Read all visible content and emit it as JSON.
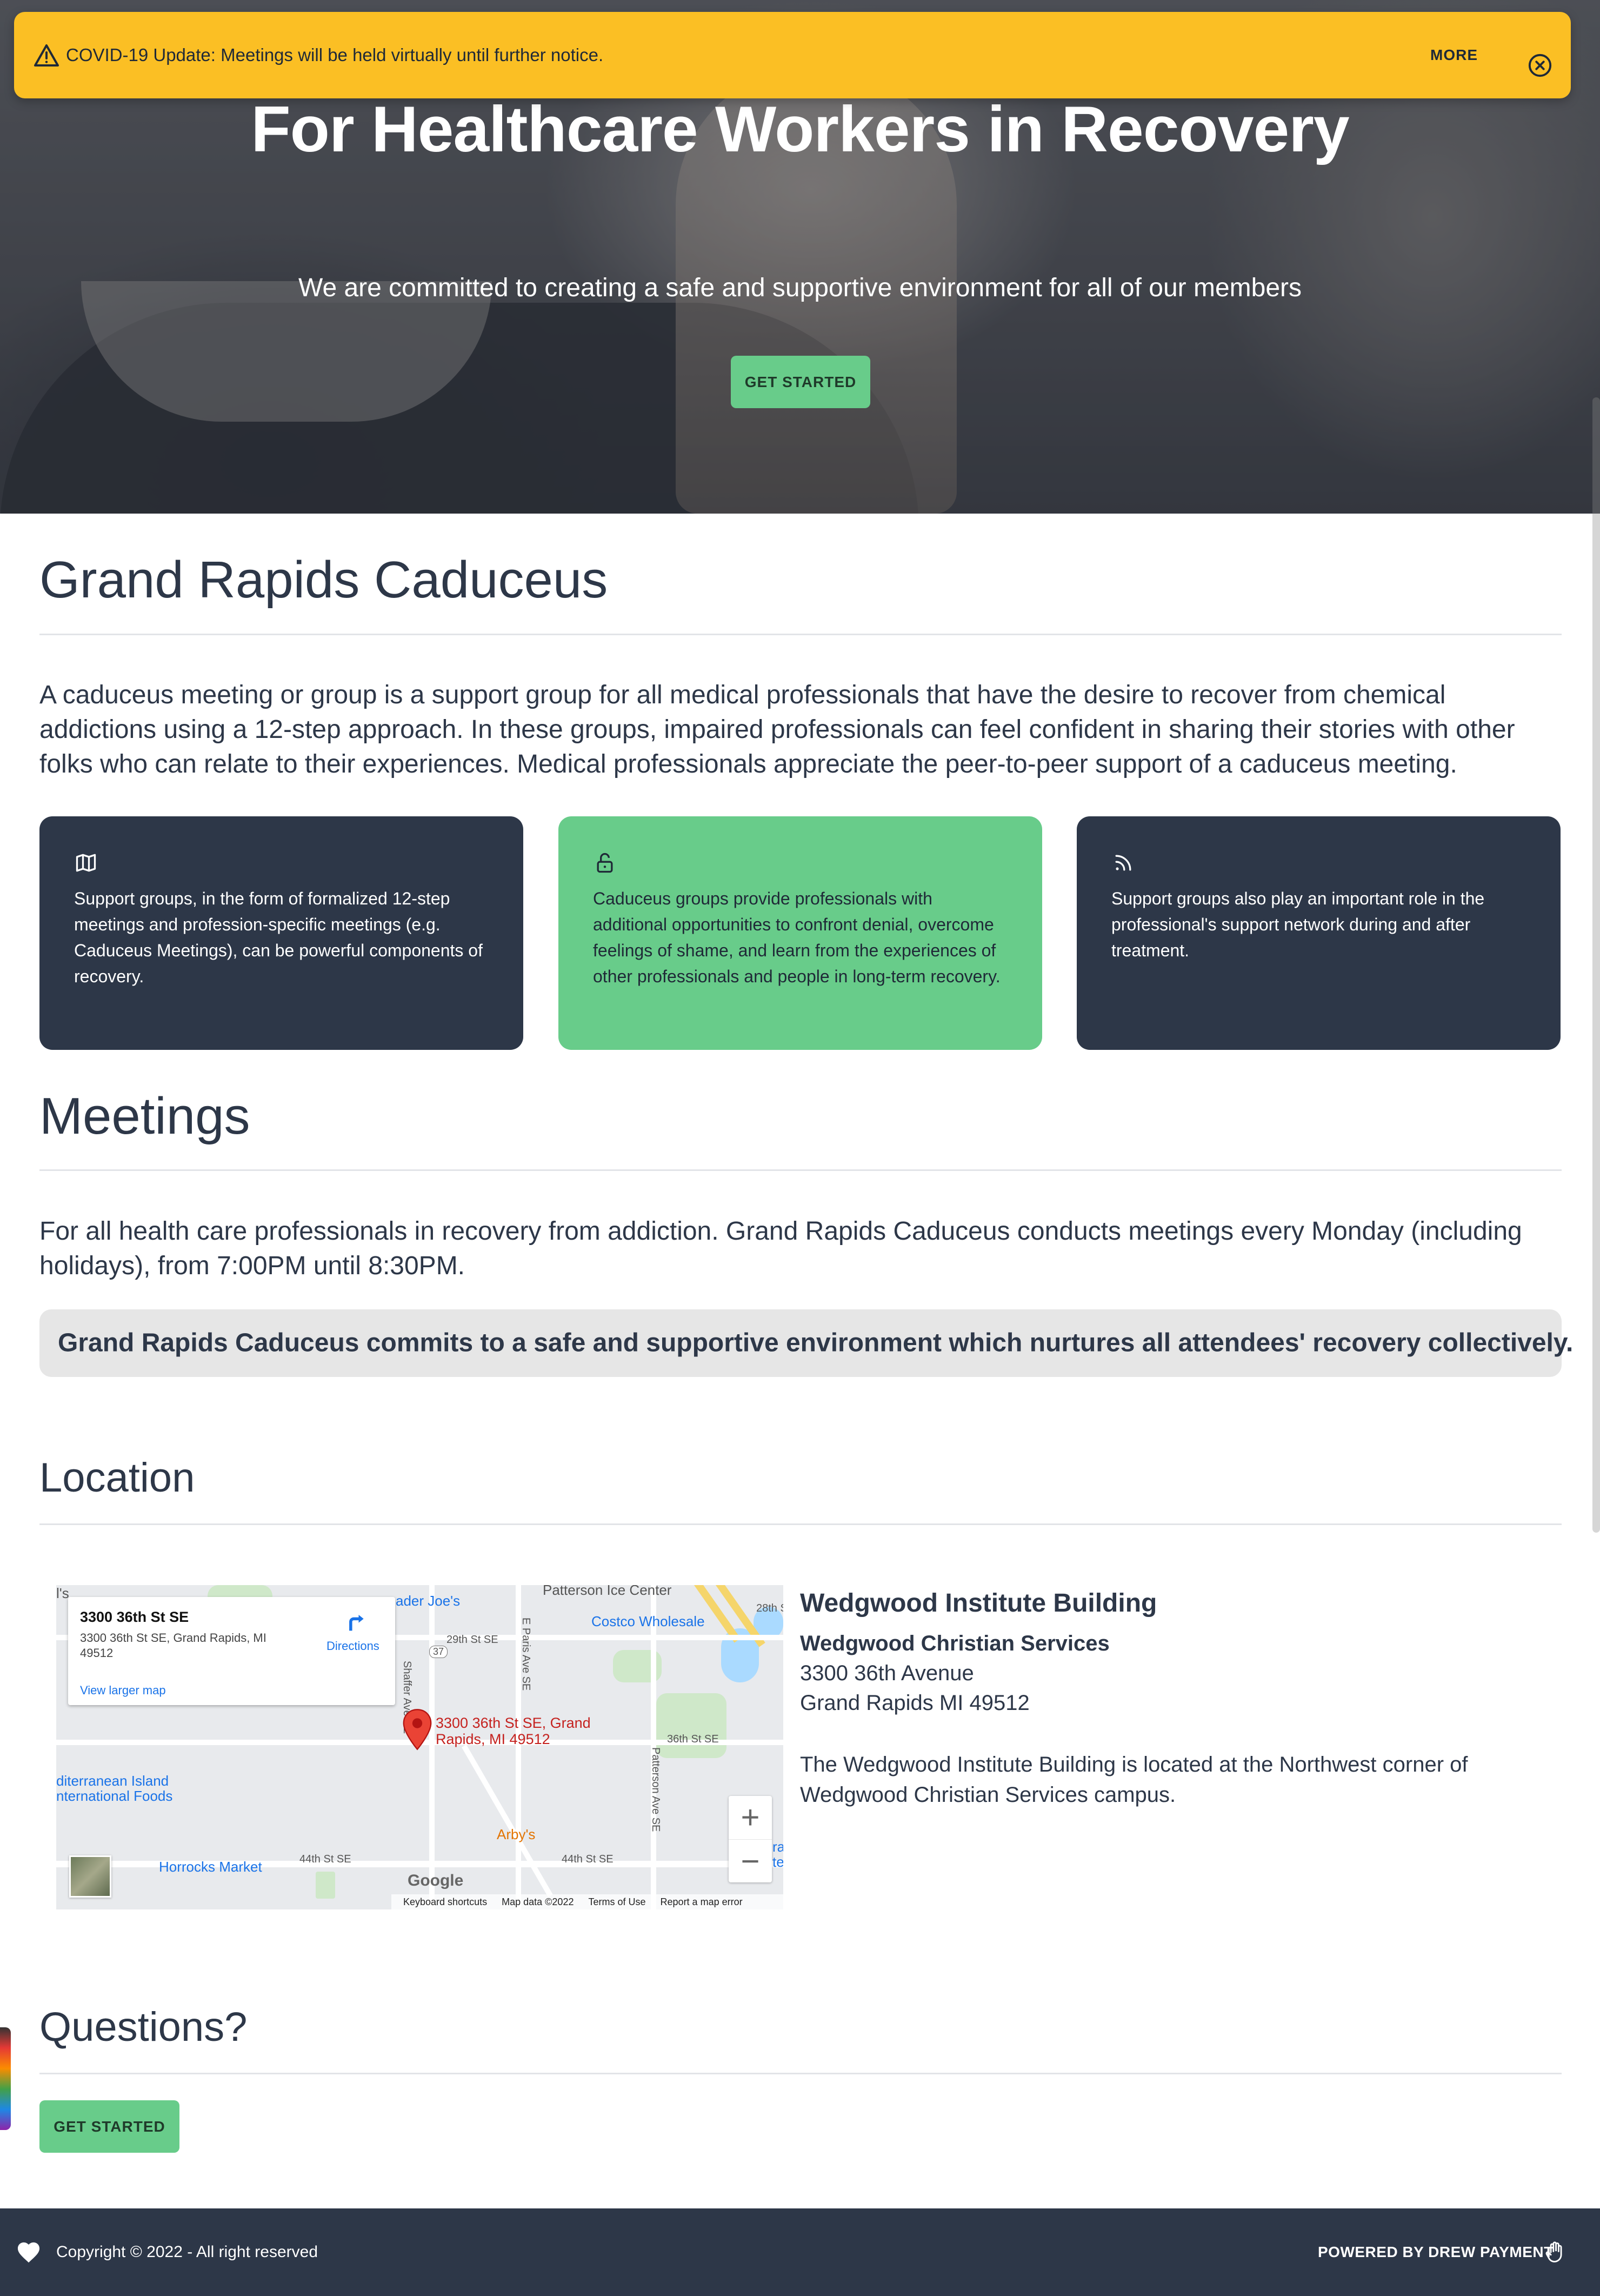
{
  "alert": {
    "message": "COVID-19 Update: Meetings will be held virtually until further notice.",
    "more_label": "MORE",
    "warning_icon": "warning-triangle-icon",
    "close_icon": "close-circle-icon",
    "background_color": "#fbbf24"
  },
  "hero": {
    "title": "For Healthcare Workers in Recovery",
    "subtitle": "We are committed to creating a safe and supportive environment for all of our members",
    "cta_label": "GET STARTED"
  },
  "about": {
    "heading": "Grand Rapids Caduceus",
    "paragraph": "A caduceus meeting or group is a support group for all medical professionals that have the desire to recover from chemical addictions using a 12-step approach. In these groups, impaired professionals can feel confident in sharing their stories with other folks who can relate to their experiences. Medical professionals appreciate the peer-to-peer support of a caduceus meeting.",
    "cards": [
      {
        "icon": "map-icon",
        "text": "Support groups, in the form of formalized 12-step meetings and profession-specific meetings (e.g. Caduceus Meetings), can be powerful components of recovery.",
        "color": "#2d3748"
      },
      {
        "icon": "unlock-icon",
        "text": "Caduceus groups provide professionals with additional opportunities to confront denial, overcome feelings of shame, and learn from the experiences of other professionals and people in long-term recovery.",
        "color": "#68cc8a"
      },
      {
        "icon": "rss-icon",
        "text": "Support groups also play an important role in the professional's support network during and after treatment.",
        "color": "#2d3748"
      }
    ]
  },
  "meetings": {
    "heading": "Meetings",
    "paragraph": "For all health care professionals in recovery from addiction. Grand Rapids Caduceus conducts meetings every Monday (including holidays), from 7:00PM until 8:30PM.",
    "quote": "Grand Rapids Caduceus commits to a safe and supportive environment which nurtures all attendees' recovery collectively."
  },
  "location": {
    "heading": "Location",
    "map": {
      "info_title": "3300 36th St SE",
      "info_address": "3300 36th St SE, Grand Rapids, MI 49512",
      "directions_label": "Directions",
      "larger_map_label": "View larger map",
      "pin_label": "3300 36th St SE, Grand Rapids, MI 49512",
      "labels": {
        "traders_joe": "ader Joe's",
        "patterson_ice": "Patterson Ice Center",
        "costco": "Costco Wholesale",
        "st29": "29th St SE",
        "st28": "28th S",
        "st36": "36th St SE",
        "st44a": "44th St SE",
        "st44b": "44th St SE",
        "shaffer": "Shaffer Ave SE",
        "eparis": "E Paris Ave SE",
        "patterson_ave": "Patterson Ave SE",
        "route37": "37",
        "mediterranean": "diterranean Island\nnternational Foods",
        "arbys": "Arby's",
        "horrocks": "Horrocks Market",
        "edge_ls": "l's",
        "edge_ra": "ra\nte"
      },
      "google_logo": "Google",
      "footer_links": [
        "Keyboard shortcuts",
        "Map data ©2022",
        "Terms of Use",
        "Report a map error"
      ],
      "zoom_in": "+",
      "zoom_out": "−"
    },
    "building": "Wedgwood Institute Building",
    "organization": "Wedgwood Christian Services",
    "street": "3300 36th Avenue",
    "city": "Grand Rapids MI 49512",
    "description": "The Wedgwood Institute Building is located at the Northwest corner of Wedgwood Christian Services campus."
  },
  "questions": {
    "heading": "Questions?",
    "cta_label": "GET STARTED"
  },
  "footer": {
    "copyright": "Copyright © 2022 - All right reserved",
    "powered_by": "POWERED BY DREW PAYMENT",
    "heart_icon": "heart-icon",
    "hand_icon": "hand-icon"
  },
  "colors": {
    "accent_green": "#68cc8a",
    "dark_slate": "#2d3748",
    "alert_yellow": "#fbbf24"
  }
}
